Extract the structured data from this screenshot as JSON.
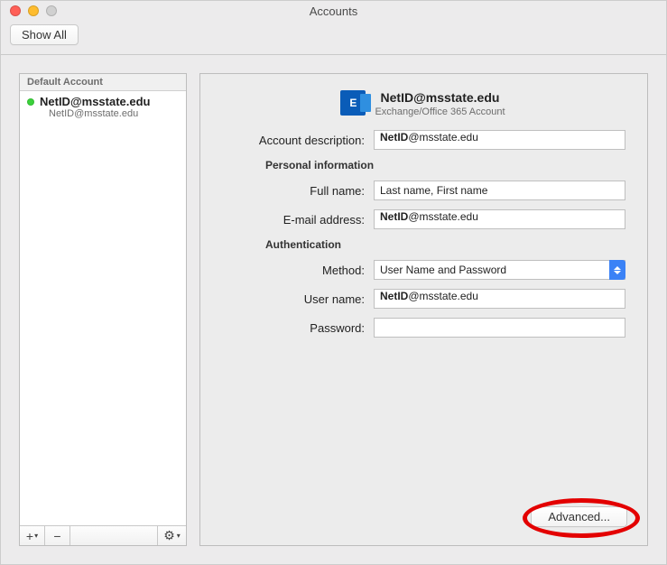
{
  "window": {
    "title": "Accounts"
  },
  "toolbar": {
    "show_all": "Show All"
  },
  "sidebar": {
    "header": "Default Account",
    "account": {
      "name_strong": "NetID",
      "name_rest": "@msstate.edu",
      "sub_strong": "NetID",
      "sub_rest": "@msstate.edu"
    },
    "footer": {
      "add": "+",
      "remove": "−",
      "gear": "⚙︎"
    }
  },
  "detail": {
    "icon_letter": "E",
    "header_strong": "NetID",
    "header_rest": "@msstate.edu",
    "header_sub": "Exchange/Office 365 Account",
    "labels": {
      "desc": "Account description:",
      "personal": "Personal information",
      "fullname": "Full name:",
      "email": "E-mail address:",
      "auth": "Authentication",
      "method": "Method:",
      "username": "User name:",
      "password": "Password:"
    },
    "values": {
      "desc_strong": "NetID",
      "desc_rest": "@msstate.edu",
      "fullname": "Last name, First name",
      "email_strong": "NetID",
      "email_rest": "@msstate.edu",
      "method": "User Name and Password",
      "username_strong": "NetID",
      "username_rest": "@msstate.edu",
      "password": ""
    },
    "advanced": "Advanced..."
  }
}
